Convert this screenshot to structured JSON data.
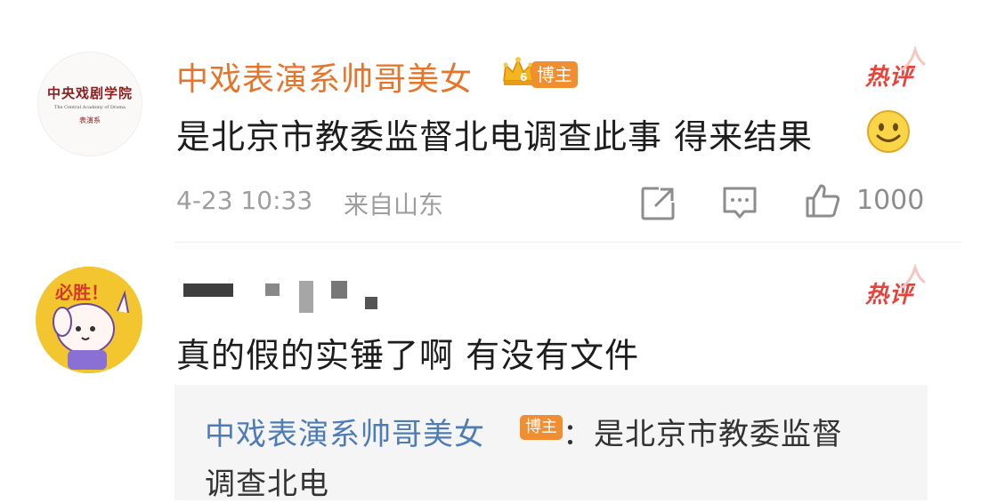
{
  "comment1": {
    "avatar": {
      "line1": "中央戏剧学院",
      "line2": "The Central Academy of Drama",
      "line3": "表演系"
    },
    "username": "中戏表演系帅哥美女",
    "role_badge": "博主",
    "hot_label": "热评",
    "text": "是北京市教委监督北电调查此事 得来结果",
    "timestamp": "4-23 10:33",
    "location": "来自山东",
    "like_count": "1000"
  },
  "comment2": {
    "hot_label": "热评",
    "text": "真的假的实锤了啊 有没有文件",
    "avatar_text": "必胜！",
    "quote": {
      "name": "中戏表演系帅哥美女",
      "badge": "博主",
      "text_line1": "：是北京市教委监督",
      "text_line2": "调查北电"
    }
  },
  "colors": {
    "username": "#e8742a",
    "badge_bg": "#f08e30",
    "hot": "#e9423a",
    "link": "#4e7cb6",
    "meta": "#9e9e9e"
  },
  "icons": [
    "crown-icon",
    "smile-emoji-icon",
    "share-icon",
    "comment-icon",
    "like-icon"
  ]
}
